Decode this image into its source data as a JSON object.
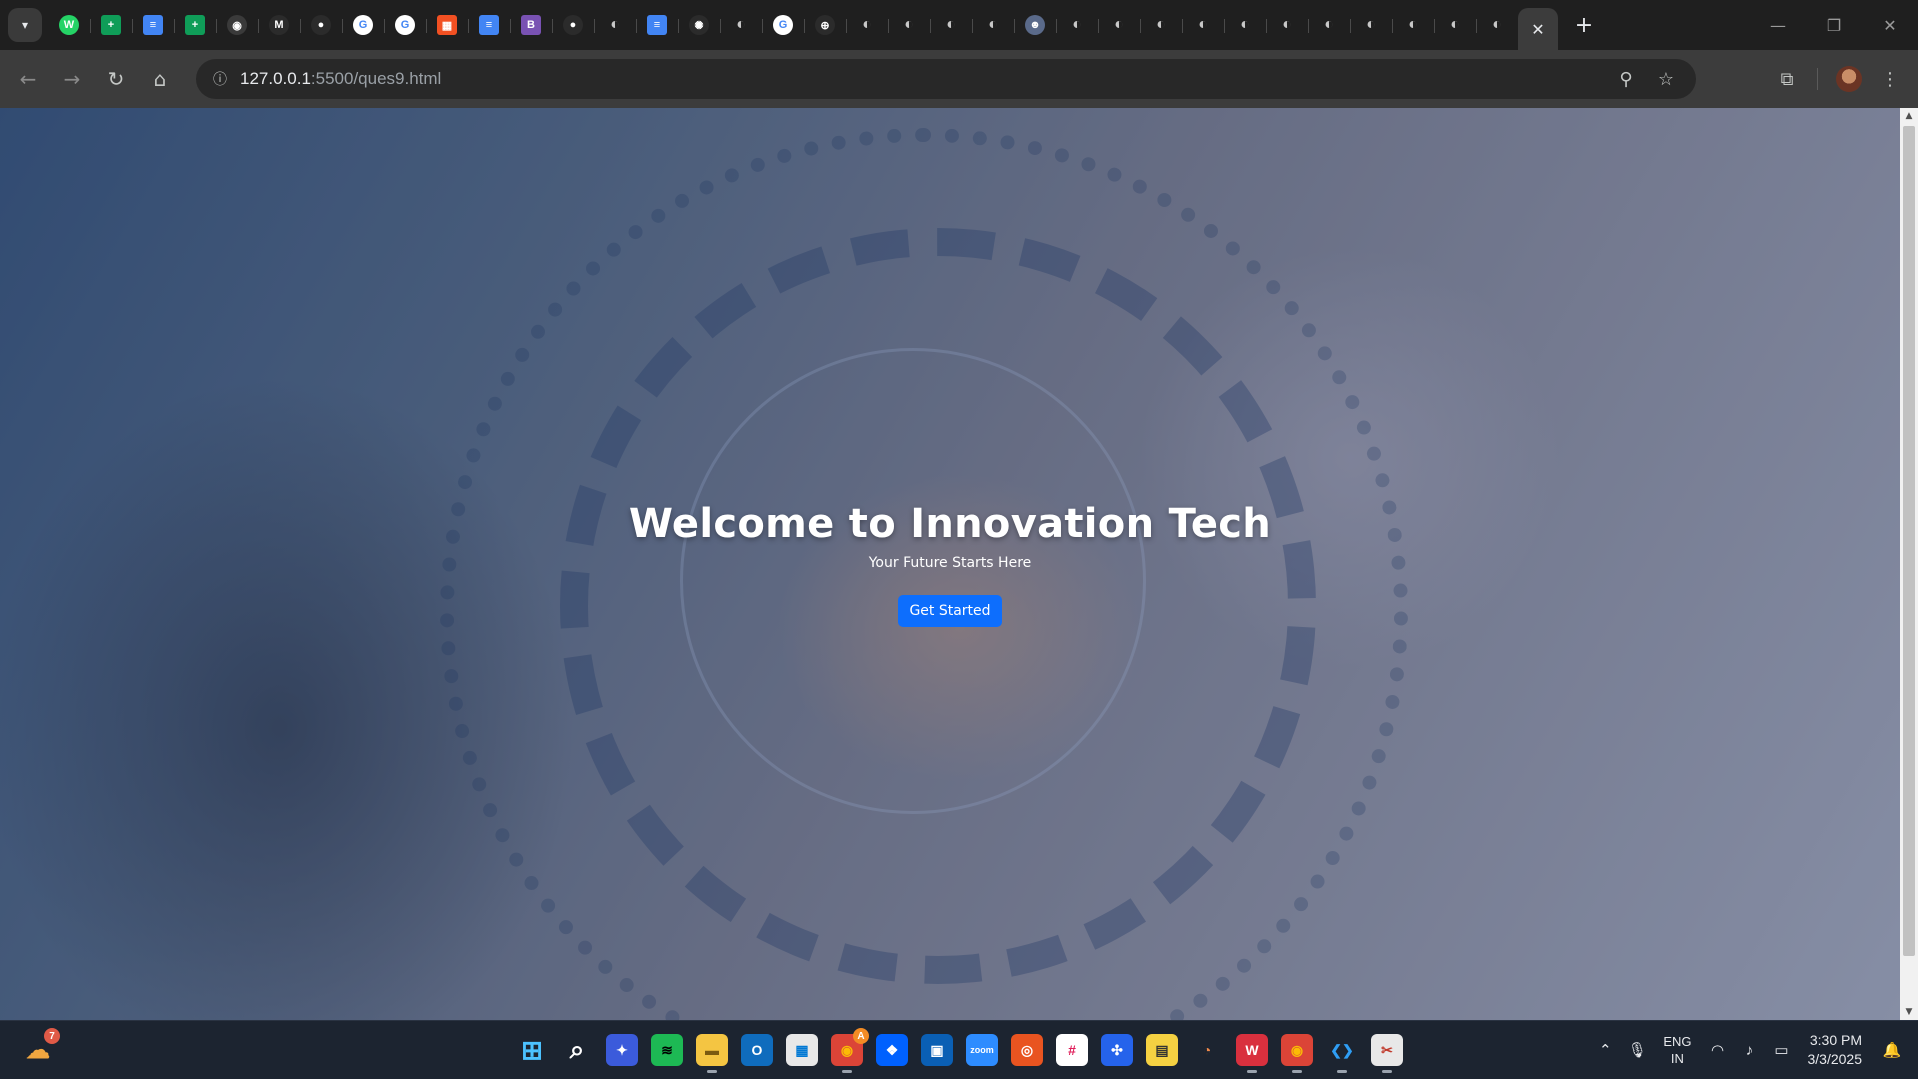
{
  "browser": {
    "tabs": [
      {
        "name": "whatsapp-tab",
        "icon": "whatsapp-icon",
        "glyph": "W",
        "color": "#25d366"
      },
      {
        "name": "sheets-tab-1",
        "icon": "sheets-icon",
        "glyph": "+",
        "color": "#0f9d58"
      },
      {
        "name": "docs-tab-1",
        "icon": "docs-icon",
        "glyph": "≡",
        "color": "#4285f4"
      },
      {
        "name": "sheets-tab-2",
        "icon": "sheets-icon",
        "glyph": "+",
        "color": "#0f9d58"
      },
      {
        "name": "record-tab",
        "icon": "record-icon",
        "glyph": "◉",
        "color": "#3a3a3a"
      },
      {
        "name": "gmail-tab",
        "icon": "gmail-icon",
        "glyph": "M",
        "color": "#2b2b2b"
      },
      {
        "name": "github-tab-1",
        "icon": "github-icon",
        "glyph": "●",
        "color": "#2b2b2b"
      },
      {
        "name": "google-tab-1",
        "icon": "google-icon",
        "glyph": "G",
        "color": "#ffffff"
      },
      {
        "name": "google-tab-2",
        "icon": "google-icon",
        "glyph": "G",
        "color": "#ffffff"
      },
      {
        "name": "microsoft-tab",
        "icon": "microsoft-icon",
        "glyph": "▦",
        "color": "#f25022"
      },
      {
        "name": "docs-tab-2",
        "icon": "docs-icon",
        "glyph": "≡",
        "color": "#4285f4"
      },
      {
        "name": "bootstrap-tab",
        "icon": "bootstrap-icon",
        "glyph": "B",
        "color": "#7952b3"
      },
      {
        "name": "github-tab-2",
        "icon": "github-icon",
        "glyph": "●",
        "color": "#2b2b2b"
      },
      {
        "name": "globe-tab-1",
        "icon": "globe-icon",
        "glyph": "◐",
        "color": "#444444"
      },
      {
        "name": "docs-tab-3",
        "icon": "docs-icon",
        "glyph": "≡",
        "color": "#4285f4"
      },
      {
        "name": "openai-tab",
        "icon": "openai-icon",
        "glyph": "✺",
        "color": "#2b2b2b"
      },
      {
        "name": "globe-tab-2",
        "icon": "globe-icon",
        "glyph": "◐",
        "color": "#444444"
      },
      {
        "name": "google-tab-3",
        "icon": "google-icon",
        "glyph": "G",
        "color": "#ffffff"
      },
      {
        "name": "pin-tab",
        "icon": "pin-icon",
        "glyph": "⊕",
        "color": "#2b2b2b"
      },
      {
        "name": "globe-tab-3",
        "icon": "globe-icon",
        "glyph": "◐",
        "color": "#444444"
      },
      {
        "name": "globe-tab-4",
        "icon": "globe-icon",
        "glyph": "◐",
        "color": "#444444"
      },
      {
        "name": "globe-tab-5",
        "icon": "globe-icon",
        "glyph": "◐",
        "color": "#444444"
      },
      {
        "name": "globe-tab-6",
        "icon": "globe-icon",
        "glyph": "◐",
        "color": "#444444"
      },
      {
        "name": "ai-tab",
        "icon": "robot-icon",
        "glyph": "☻",
        "color": "#5a6a8a"
      },
      {
        "name": "globe-tab-7",
        "icon": "globe-icon",
        "glyph": "◐",
        "color": "#444444"
      },
      {
        "name": "globe-tab-8",
        "icon": "globe-icon",
        "glyph": "◐",
        "color": "#444444"
      },
      {
        "name": "globe-tab-9",
        "icon": "globe-icon",
        "glyph": "◐",
        "color": "#444444"
      },
      {
        "name": "globe-tab-10",
        "icon": "globe-icon",
        "glyph": "◐",
        "color": "#444444"
      },
      {
        "name": "globe-tab-11",
        "icon": "globe-icon",
        "glyph": "◐",
        "color": "#444444"
      },
      {
        "name": "globe-tab-12",
        "icon": "globe-icon",
        "glyph": "◐",
        "color": "#444444"
      },
      {
        "name": "globe-tab-13",
        "icon": "globe-icon",
        "glyph": "◐",
        "color": "#444444"
      },
      {
        "name": "globe-tab-14",
        "icon": "globe-icon",
        "glyph": "◐",
        "color": "#444444"
      },
      {
        "name": "globe-tab-15",
        "icon": "globe-icon",
        "glyph": "◐",
        "color": "#444444"
      },
      {
        "name": "globe-tab-16",
        "icon": "globe-icon",
        "glyph": "◐",
        "color": "#444444"
      },
      {
        "name": "globe-tab-17",
        "icon": "globe-icon",
        "glyph": "◐",
        "color": "#444444"
      }
    ],
    "active_tab_close": "✕",
    "new_tab": "+",
    "url_host": "127.0.0.1",
    "url_path": ":5500/ques9.html"
  },
  "page": {
    "title": "Welcome to Innovation Tech",
    "subtitle": "Your Future Starts Here",
    "cta_label": "Get Started",
    "cta_color": "#0d6efd"
  },
  "taskbar": {
    "apps": [
      {
        "name": "start-button",
        "icon": "windows-icon",
        "glyph": "⊞",
        "bg": "transparent",
        "fg": "#4cc2ff",
        "running": false
      },
      {
        "name": "search-button",
        "icon": "search-icon",
        "glyph": "⌕",
        "bg": "transparent",
        "fg": "#ffffff",
        "running": false
      },
      {
        "name": "copilot-app",
        "icon": "copilot-icon",
        "glyph": "✦",
        "bg": "#3b5bdb",
        "fg": "#ffffff",
        "running": false
      },
      {
        "name": "spotify-app",
        "icon": "spotify-icon",
        "glyph": "≋",
        "bg": "#1db954",
        "fg": "#000000",
        "running": false
      },
      {
        "name": "file-explorer-app",
        "icon": "folder-icon",
        "glyph": "▬",
        "bg": "#f4c542",
        "fg": "#7a5a10",
        "running": true
      },
      {
        "name": "outlook-app",
        "icon": "outlook-icon",
        "glyph": "O",
        "bg": "#0f6cbd",
        "fg": "#ffffff",
        "running": false
      },
      {
        "name": "store-app",
        "icon": "store-icon",
        "glyph": "▦",
        "bg": "#e8e8e8",
        "fg": "#0078d4",
        "running": false
      },
      {
        "name": "chrome-app-1",
        "icon": "chrome-icon",
        "glyph": "◉",
        "bg": "#db4437",
        "fg": "#fbbc05",
        "running": true,
        "badge": "A"
      },
      {
        "name": "dropbox-app",
        "icon": "dropbox-icon",
        "glyph": "❖",
        "bg": "#0061fe",
        "fg": "#ffffff",
        "running": false
      },
      {
        "name": "app-blue",
        "icon": "window-icon",
        "glyph": "▣",
        "bg": "#0a5fb4",
        "fg": "#ffffff",
        "running": false
      },
      {
        "name": "zoom-app",
        "icon": "zoom-icon",
        "glyph": "zoom",
        "bg": "#2d8cff",
        "fg": "#ffffff",
        "running": false
      },
      {
        "name": "ubuntu-app",
        "icon": "ubuntu-icon",
        "glyph": "◎",
        "bg": "#e95420",
        "fg": "#ffffff",
        "running": false
      },
      {
        "name": "slack-app",
        "icon": "slack-icon",
        "glyph": "#",
        "bg": "#ffffff",
        "fg": "#e01e5a",
        "running": false
      },
      {
        "name": "app-teal",
        "icon": "network-icon",
        "glyph": "✣",
        "bg": "#2563eb",
        "fg": "#ffffff",
        "running": false
      },
      {
        "name": "sticky-app",
        "icon": "sticky-icon",
        "glyph": "▤",
        "bg": "#f5d142",
        "fg": "#333333",
        "running": false
      },
      {
        "name": "app-orange",
        "icon": "orbit-icon",
        "glyph": "◔",
        "bg": "transparent",
        "fg": "#f08a4b",
        "running": false
      },
      {
        "name": "wps-app",
        "icon": "wps-icon",
        "glyph": "W",
        "bg": "#d9303e",
        "fg": "#ffffff",
        "running": true
      },
      {
        "name": "chrome-app-2",
        "icon": "chrome-icon",
        "glyph": "◉",
        "bg": "#db4437",
        "fg": "#fbbc05",
        "running": true
      },
      {
        "name": "vscode-app",
        "icon": "vscode-icon",
        "glyph": "❮❯",
        "bg": "transparent",
        "fg": "#2f9ef4",
        "running": true
      },
      {
        "name": "snip-app",
        "icon": "snip-icon",
        "glyph": "✂",
        "bg": "#e8e8e8",
        "fg": "#c0392b",
        "running": true
      }
    ],
    "widgets_badge": "7",
    "lang_line1": "ENG",
    "lang_line2": "IN",
    "time": "3:30 PM",
    "date": "3/3/2025"
  }
}
